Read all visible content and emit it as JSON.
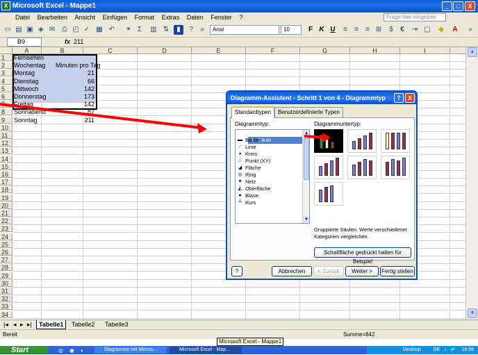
{
  "window": {
    "title": "Microsoft Excel - Mappe1",
    "app_icon_label": "X",
    "minimize_label": "_",
    "maximize_label": "□",
    "close_label": "X"
  },
  "menu": {
    "items": [
      "Datei",
      "Bearbeiten",
      "Ansicht",
      "Einfügen",
      "Format",
      "Extras",
      "Daten",
      "Fenster",
      "?"
    ],
    "help_placeholder": "Frage hier eingeben"
  },
  "toolbar": {
    "font_name": "Arial",
    "font_size": "10",
    "bold_label": "F",
    "italic_label": "K",
    "underline_label": "U",
    "euro_label": "€"
  },
  "formula_bar": {
    "name_box": "B9",
    "fx_label": "fx",
    "value": "211"
  },
  "sheet": {
    "columns": [
      "A",
      "B",
      "C",
      "D",
      "E",
      "F",
      "G",
      "H",
      "I",
      "J",
      "K",
      "L"
    ],
    "row_numbers": [
      "1",
      "2",
      "3",
      "4",
      "5",
      "6",
      "7",
      "8",
      "9",
      "10",
      "11",
      "12",
      "13",
      "14",
      "15",
      "16",
      "17",
      "18",
      "19",
      "20",
      "21",
      "22",
      "23",
      "24",
      "25",
      "26",
      "27",
      "28",
      "29",
      "30",
      "31",
      "32",
      "33",
      "34"
    ],
    "col_a": [
      "Fernsehen",
      "Wochentag",
      "Montag",
      "Dienstag",
      "Mittwoch",
      "Donnerstag",
      "Freitag",
      "Sonnabend",
      "Sonntag"
    ],
    "b2": "Minuten pro Tag",
    "col_b_values": [
      "21",
      "66",
      "142",
      "173",
      "142",
      "87",
      "211"
    ]
  },
  "sheet_tabs": [
    "Tabelle1",
    "Tabelle2",
    "Tabelle3"
  ],
  "status": {
    "left": "Bereit",
    "sum": "Summe=842"
  },
  "tooltip": "Microsoft Excel - Mappe1",
  "taskbar": {
    "start_label": "Start",
    "tasks": [
      "Diagramme mit Micros...",
      "Microsoft Excel - Map..."
    ],
    "tray_desktop": "Desktop",
    "tray_lang": "DE",
    "clock": "16:58"
  },
  "dialog": {
    "title": "Diagramm-Assistent - Schritt 1 von 4 - Diagrammtyp",
    "help_label": "?",
    "close_label": "X",
    "tabs": [
      "Standardtypen",
      "Benutzerdefinierte Typen"
    ],
    "type_label": "Diagrammtyp:",
    "subtype_label": "Diagrammuntertyp:",
    "types": [
      "Säule",
      "Balken",
      "Linie",
      "Kreis",
      "Punkt (XY)",
      "Fläche",
      "Ring",
      "Netz",
      "Oberfläche",
      "Blase",
      "Kurs"
    ],
    "description": "Gruppierte Säulen. Werte verschiedener Kategorien vergleichen.",
    "preview_button": "Schaltfläche gedrückt halten für Beispiel",
    "buttons": {
      "cancel": "Abbrechen",
      "back": "< Zurück",
      "next": "Weiter >",
      "finish": "Fertig stellen"
    }
  },
  "colors": {
    "title_blue": "#0a5fd8",
    "selection": "#b8c8ec",
    "arrow_red": "#ff0000",
    "bar_blue": "#7c7cd8",
    "bar_maroon": "#9b2d5a",
    "bar_yellow": "#fff3b0",
    "bar_green": "#2f8a3a"
  }
}
